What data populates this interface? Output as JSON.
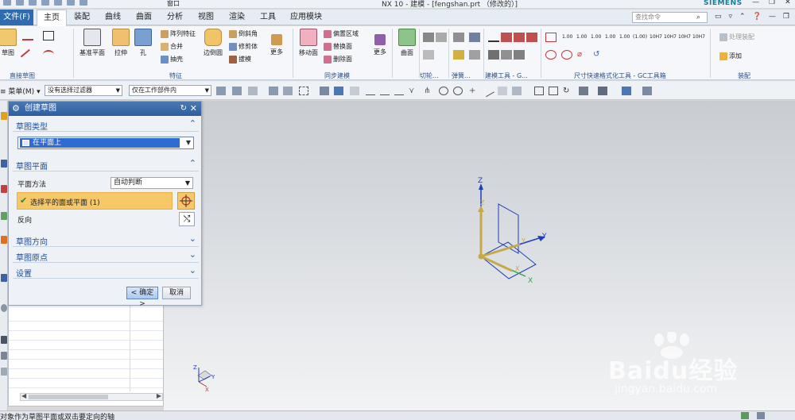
{
  "window": {
    "title": "NX 10 - 建模 - [fengshan.prt （修改的）]",
    "brand": "SIEMENS",
    "qat_dropdown_label": "窗口"
  },
  "tabs": {
    "file": "文件(F)",
    "items": [
      "主页",
      "装配",
      "曲线",
      "曲面",
      "分析",
      "视图",
      "渲染",
      "工具",
      "应用模块"
    ],
    "active": "主页",
    "search_placeholder": "查找命令"
  },
  "ribbon": {
    "sketch_group": {
      "label": "直接草图",
      "sketch_label": "草图"
    },
    "feature_group": {
      "label": "特征",
      "datum_plane": "基准平面",
      "extrude": "拉伸",
      "hole": "孔",
      "pattern": "阵列特征",
      "unite": "合并",
      "shell": "抽壳",
      "edge_blend": "边倒圆",
      "chamfer": "倒斜角",
      "trim_body": "修剪体",
      "draft": "拔模",
      "more": "更多"
    },
    "sync_group": {
      "label": "同步建模",
      "move_face": "移动面",
      "offset_region": "偏置区域",
      "replace_face": "替换面",
      "delete_face": "删除面",
      "more": "更多"
    },
    "surface_group": {
      "label": "曲面",
      "surface": "曲面"
    },
    "cut_group": {
      "label": "切轮..."
    },
    "spring_group": {
      "label": "弹簧..."
    },
    "build_group": {
      "label": "建模工具 - G..."
    },
    "dim_group": {
      "label": "尺寸快速格式化工具 - GC工具箱",
      "dim_codes": [
        "1.00",
        "1.00",
        "1.00",
        "1.00",
        "1.00",
        "(1.00)",
        "10H7",
        "10H7",
        "10H7",
        "10H7"
      ]
    },
    "assembly_group": {
      "label": "装配",
      "add": "添加",
      "process_assembly": "处理装配"
    }
  },
  "selbar": {
    "menu": "菜单(M)",
    "filter": "没有选择过滤器",
    "scope": "仅在工作部件内"
  },
  "dialog": {
    "title": "创建草图",
    "sections": {
      "type": "草图类型",
      "plane": "草图平面",
      "orientation": "草图方向",
      "origin": "草图原点",
      "settings": "设置"
    },
    "type_value": "在平面上",
    "plane_method_label": "平面方法",
    "plane_method_value": "自动判断",
    "select_plane_label": "选择平的面或平面 (1)",
    "reverse_label": "反向",
    "ok": "< 确定 >",
    "cancel": "取消"
  },
  "axes": {
    "x": "X",
    "y": "Y",
    "z": "Z"
  },
  "statusbar": {
    "message": "对象作为草图平面或双击要定向的轴"
  },
  "watermark": {
    "text": "Baidu经验",
    "url": "jingyan.baidu.com"
  },
  "colors": {
    "file_tab": "#2e6bb0",
    "dialog_title": "#2f5e9e",
    "selection_highlight": "#f6c867",
    "axis_x": "#2fa84f",
    "axis_y": "#1c3fb8",
    "axis_z": "#1c3fb8",
    "triad": "#c8a94a"
  }
}
